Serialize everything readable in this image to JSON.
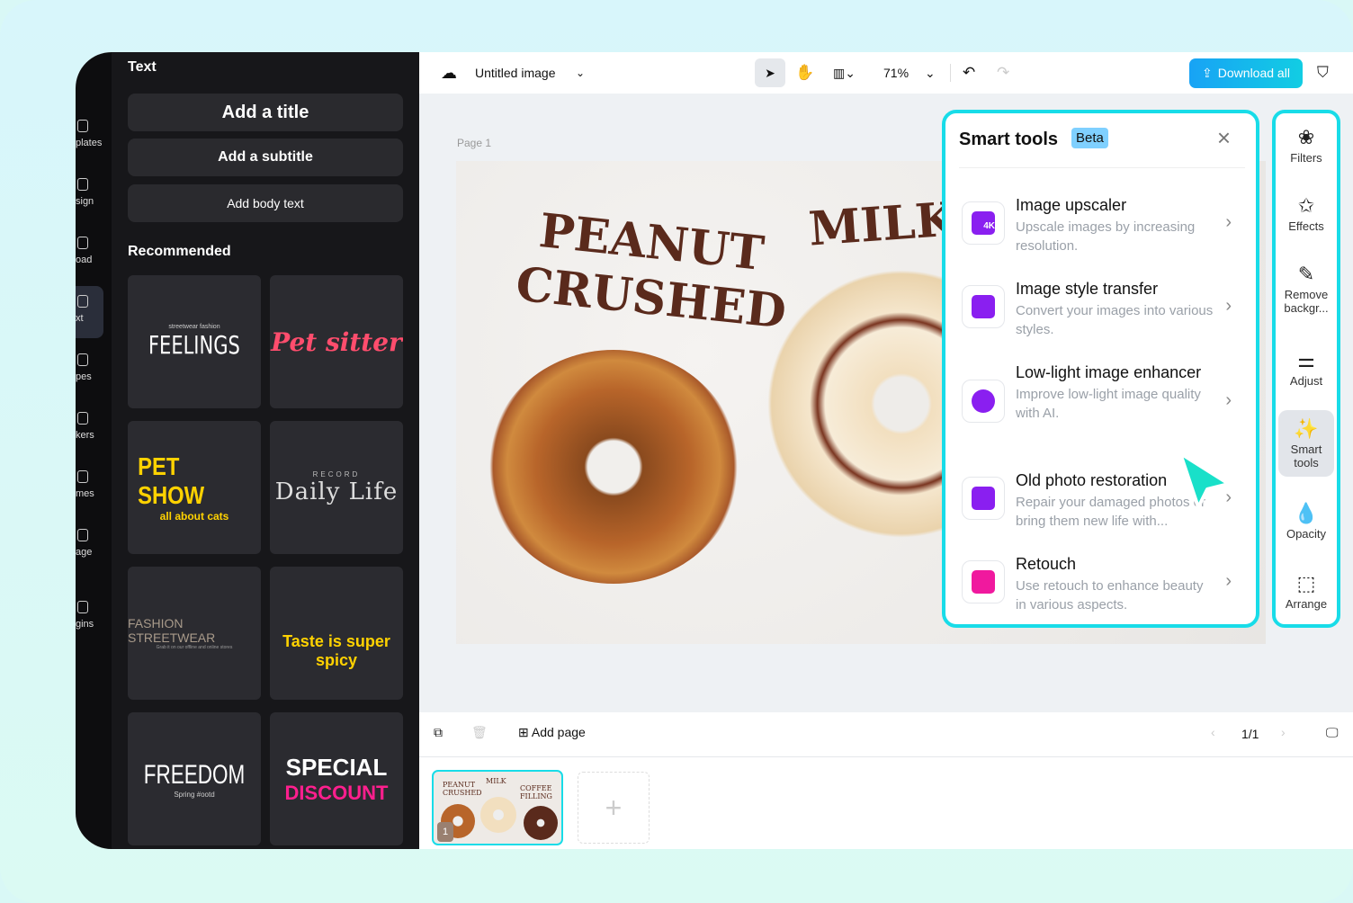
{
  "rail": {
    "items": [
      "plates",
      "sign",
      "oad",
      "xt",
      "pes",
      "kers",
      "mes",
      "age",
      "gins"
    ]
  },
  "text_panel": {
    "title": "Text",
    "add_title": "Add a title",
    "add_subtitle": "Add a subtitle",
    "add_body": "Add body text",
    "recommended": "Recommended",
    "templates": [
      {
        "small": "streetwear fashion",
        "main": "FEELINGS",
        "color": "#ffffff"
      },
      {
        "main": "Pet sitter",
        "color": "#ff4d6d"
      },
      {
        "main": "PET SHOW",
        "small": "all about cats",
        "color": "#ffd200"
      },
      {
        "small": "RECORD",
        "main": "Daily Life",
        "color": "#dddddd"
      },
      {
        "main": "FASHION STREETWEAR",
        "small": "Grab it on our offline and online stores",
        "color": "#a89a8a"
      },
      {
        "main": "Taste is super spicy",
        "color": "#ffd200"
      },
      {
        "main": "FREEDOM",
        "small": "Spring #ootd",
        "color": "#ffffff"
      },
      {
        "main": "SPECIAL",
        "small": "DISCOUNT",
        "color": "#ffffff",
        "accent": "#ff1f8e"
      }
    ]
  },
  "topbar": {
    "doc_title": "Untitled image",
    "zoom": "71%",
    "download": "Download all"
  },
  "canvas": {
    "page_label": "Page 1",
    "text1": "PEANUT",
    "text2": "CRUSHED",
    "text3": "MILK"
  },
  "smart_tools": {
    "title": "Smart tools",
    "badge": "Beta",
    "items": [
      {
        "title": "Image upscaler",
        "desc": "Upscale images by increasing resolution.",
        "icon": "4K"
      },
      {
        "title": "Image style transfer",
        "desc": "Convert your images into various styles.",
        "icon": ""
      },
      {
        "title": "Low-light image enhancer",
        "desc": "Improve low-light image quality with AI.",
        "icon": ""
      },
      {
        "title": "Old photo restoration",
        "desc": "Repair your damaged photos or bring them new life with...",
        "icon": ""
      },
      {
        "title": "Retouch",
        "desc": "Use retouch to enhance beauty in various aspects.",
        "icon": ""
      }
    ]
  },
  "right_tools": [
    {
      "label": "Filters",
      "glyph": "❀"
    },
    {
      "label": "Effects",
      "glyph": "✩"
    },
    {
      "label": "Remove backgr...",
      "glyph": "✎"
    },
    {
      "label": "Adjust",
      "glyph": "⚌"
    },
    {
      "label": "Smart tools",
      "glyph": "✨"
    },
    {
      "label": "Opacity",
      "glyph": "💧"
    },
    {
      "label": "Arrange",
      "glyph": "⬚"
    }
  ],
  "bottom": {
    "add_page": "Add page",
    "page_counter": "1/1",
    "thumb_number": "1",
    "thumb_texts": [
      "PEANUT CRUSHED",
      "MILK",
      "COFFEE FILLING"
    ]
  },
  "colors": {
    "accent": "#18dce8",
    "download": "#1aa8f5",
    "purple": "#8a1ff0",
    "cursor": "#19e0c9"
  }
}
